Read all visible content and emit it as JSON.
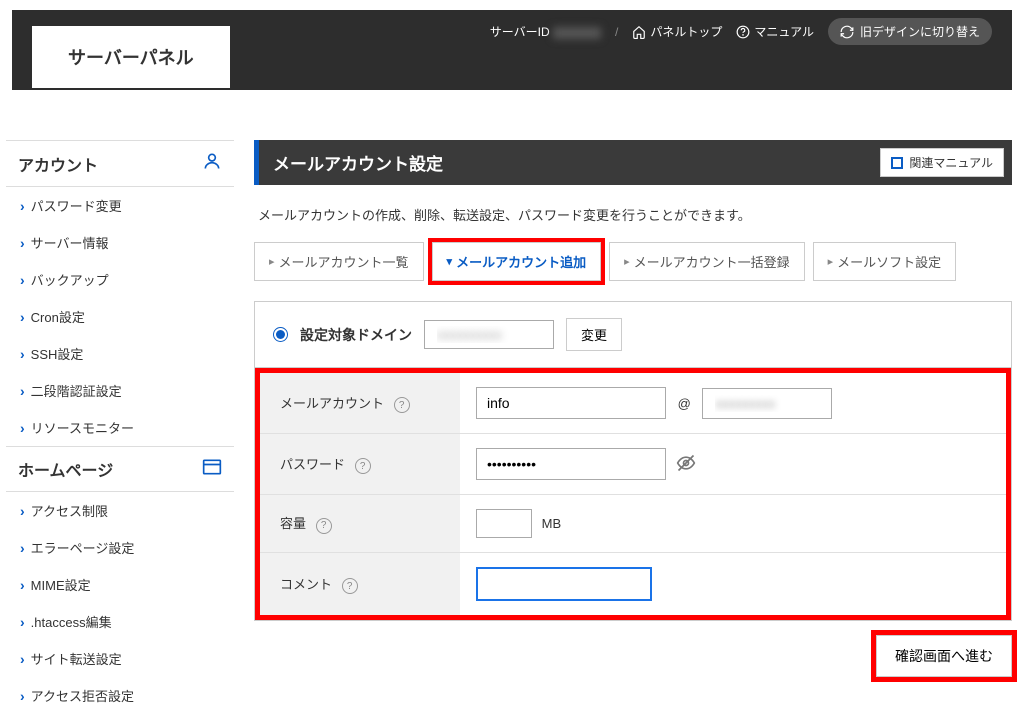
{
  "topbar": {
    "server_id_label": "サーバーID",
    "panel_top": "パネルトップ",
    "manual": "マニュアル",
    "switch_design": "旧デザインに切り替え"
  },
  "logo": "サーバーパネル",
  "sidebar": {
    "sections": [
      {
        "title": "アカウント",
        "icon_name": "user-icon",
        "items": [
          "パスワード変更",
          "サーバー情報",
          "バックアップ",
          "Cron設定",
          "SSH設定",
          "二段階認証設定",
          "リソースモニター"
        ]
      },
      {
        "title": "ホームページ",
        "icon_name": "window-icon",
        "items": [
          "アクセス制限",
          "エラーページ設定",
          "MIME設定",
          ".htaccess編集",
          "サイト転送設定",
          "アクセス拒否設定"
        ]
      }
    ]
  },
  "page": {
    "title": "メールアカウント設定",
    "related_manual": "関連マニュアル",
    "description": "メールアカウントの作成、削除、転送設定、パスワード変更を行うことができます。"
  },
  "tabs": [
    "メールアカウント一覧",
    "メールアカウント追加",
    "メールアカウント一括登録",
    "メールソフト設定"
  ],
  "active_tab_index": 1,
  "form": {
    "target_domain_label": "設定対象ドメイン",
    "change_button": "変更",
    "fields": {
      "account_label": "メールアカウント",
      "account_value": "info",
      "at": "@",
      "password_label": "パスワード",
      "password_value": "••••••••••",
      "capacity_label": "容量",
      "capacity_unit": "MB",
      "comment_label": "コメント",
      "comment_value": ""
    },
    "submit": "確認画面へ進む"
  }
}
